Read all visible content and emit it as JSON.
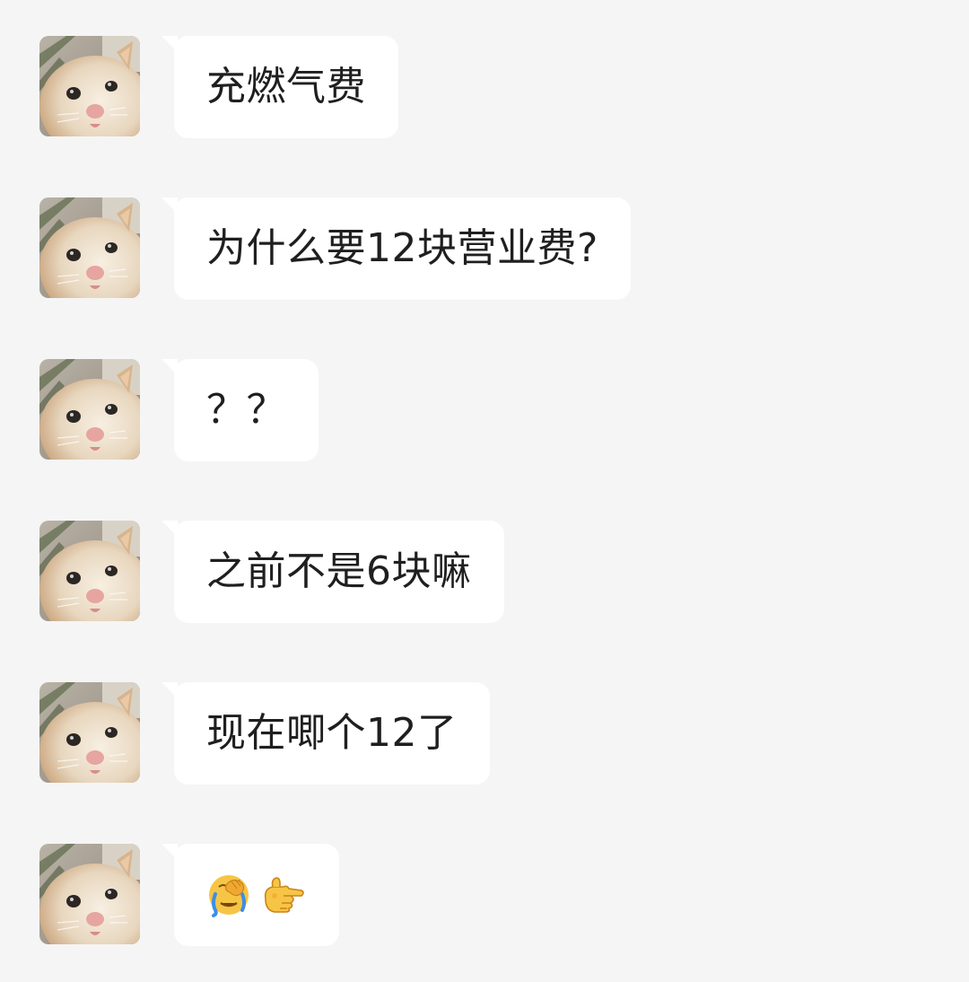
{
  "messages": [
    {
      "type": "text",
      "text": "充燃气费"
    },
    {
      "type": "text",
      "text": "为什么要12块营业费?"
    },
    {
      "type": "text",
      "text": "？？"
    },
    {
      "type": "text",
      "text": "之前不是6块嘛"
    },
    {
      "type": "text",
      "text": "现在唧个12了"
    },
    {
      "type": "emoji",
      "emojis": [
        "facepalm-crying-emoji",
        "pointing-hand-emoji"
      ]
    }
  ],
  "colors": {
    "background": "#f5f5f5",
    "bubble": "#ffffff",
    "text": "#1f1f1f"
  }
}
